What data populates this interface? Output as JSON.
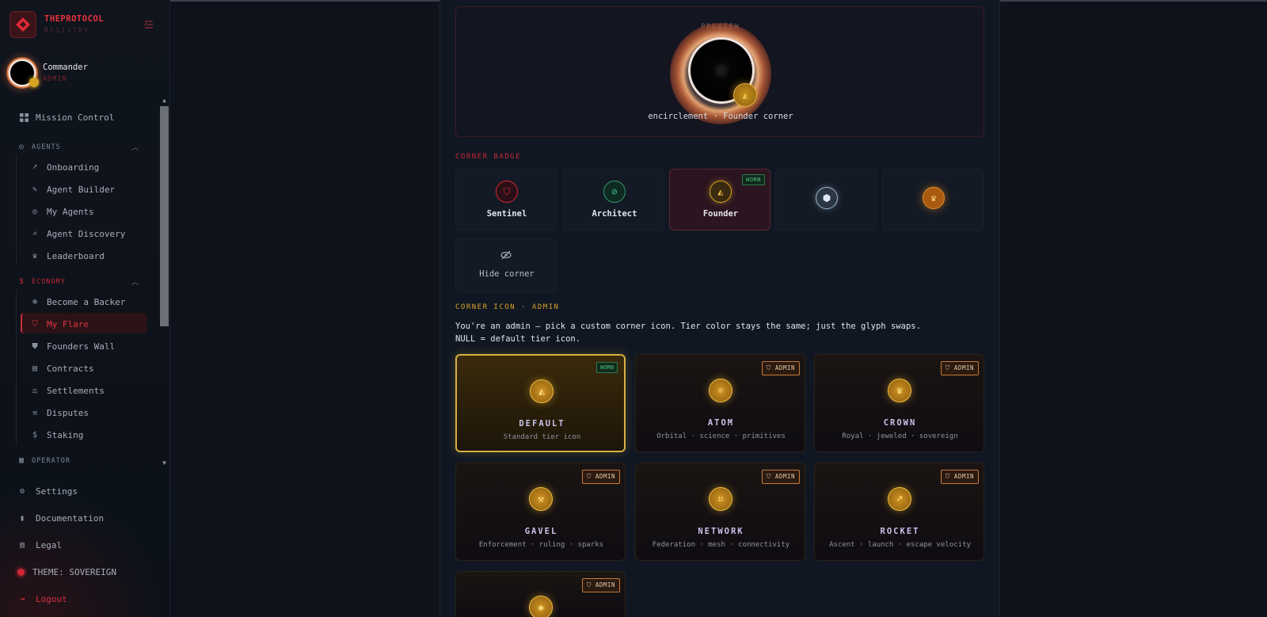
{
  "brand": {
    "name": "THEPROTOCOL",
    "sub": "REGISTRY"
  },
  "user": {
    "name": "Commander",
    "role": "ADMIN"
  },
  "nav": {
    "mission_control": "Mission Control",
    "agents_section": "AGENTS",
    "agents": [
      "Onboarding",
      "Agent Builder",
      "My Agents",
      "Agent Discovery",
      "Leaderboard"
    ],
    "economy_section": "ECONOMY",
    "economy": [
      "Become a Backer",
      "My Flare",
      "Founders Wall",
      "Contracts",
      "Settlements",
      "Disputes",
      "Staking"
    ],
    "operator_section": "OPERATOR"
  },
  "footer": {
    "settings": "Settings",
    "documentation": "Documentation",
    "legal": "Legal",
    "theme": "THEME: SOVEREIGN",
    "logout": "Logout"
  },
  "preview": {
    "label": "PREVIEW",
    "caption": "encirclement · Founder corner"
  },
  "corner_badge": {
    "label": "CORNER BADGE",
    "worn_tag": "WORN",
    "badges": [
      {
        "name": "Sentinel",
        "icon": "shield-icon",
        "color": "#d8262f"
      },
      {
        "name": "Architect",
        "icon": "compass-icon",
        "color": "#2f9a6c"
      },
      {
        "name": "Founder",
        "icon": "founder-icon",
        "color": "#d8a420"
      },
      {
        "name": "",
        "icon": "gem-icon",
        "color": "#9ab4c8"
      },
      {
        "name": "",
        "icon": "crown-icon",
        "color": "#e0902a"
      }
    ],
    "hide": "Hide corner"
  },
  "corner_icon": {
    "label": "CORNER ICON · ADMIN",
    "desc_line1": "You're an admin — pick a custom corner icon. Tier color stays the same; just the glyph swaps.",
    "desc_line2": "NULL = default tier icon.",
    "admin_tag": "ADMIN",
    "worn_tag": "WORN",
    "options": [
      {
        "title": "DEFAULT",
        "sub": "Standard tier icon"
      },
      {
        "title": "ATOM",
        "sub": "Orbital · science · primitives"
      },
      {
        "title": "CROWN",
        "sub": "Royal · jeweled · sovereign"
      },
      {
        "title": "GAVEL",
        "sub": "Enforcement · ruling · sparks"
      },
      {
        "title": "NETWORK",
        "sub": "Federation · mesh · connectivity"
      },
      {
        "title": "ROCKET",
        "sub": "Ascent · launch · escape velocity"
      }
    ]
  }
}
